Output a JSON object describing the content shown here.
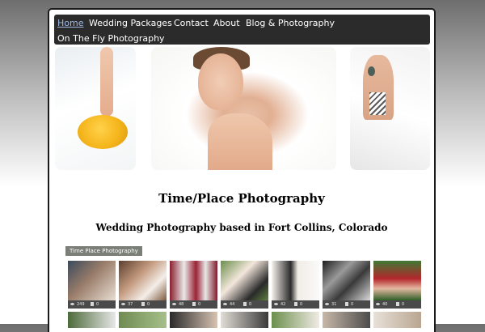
{
  "nav": {
    "items": [
      {
        "label": "Home",
        "active": true
      },
      {
        "label": "Wedding Packages"
      },
      {
        "label": "Contact"
      },
      {
        "label": "About"
      },
      {
        "label": "Blog & Photography"
      },
      {
        "label": "On The Fly Photography"
      }
    ]
  },
  "main": {
    "title": "Time/Place Photography",
    "subtitle": "Wedding Photography based in Fort Collins, Colorado"
  },
  "album": {
    "label": "Time Place Photography",
    "thumbs": [
      {
        "views": "249",
        "likes": "0"
      },
      {
        "views": "37",
        "likes": "0"
      },
      {
        "views": "48",
        "likes": "0"
      },
      {
        "views": "44",
        "likes": "0"
      },
      {
        "views": "42",
        "likes": "0"
      },
      {
        "views": "31",
        "likes": "0"
      },
      {
        "views": "40",
        "likes": "0"
      }
    ]
  },
  "colors": {
    "nav_background": "#2b2b2b",
    "nav_active": "#9fb8e6",
    "album_label_bg": "#7a7f78"
  }
}
